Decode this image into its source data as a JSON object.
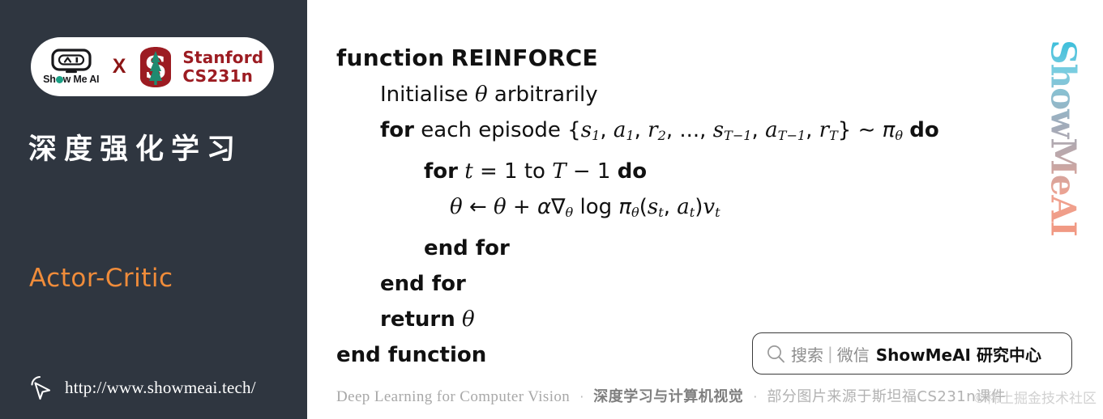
{
  "sidebar": {
    "brand": {
      "showmeai_wordmark_pre": "Sh",
      "showmeai_wordmark_post": "w Me AI",
      "cross_label": "X",
      "stanford_line1": "Stanford",
      "stanford_line2": "CS231n"
    },
    "course_title_cn": "深度强化学习",
    "topic_title": "Actor-Critic",
    "site_url": "http://www.showmeai.tech/",
    "colors": {
      "background": "#2f3640",
      "accent_orange": "#f08c3a",
      "stanford_red": "#9c1c22",
      "text_white": "#ffffff"
    }
  },
  "main": {
    "algorithm": {
      "line1_kw": "function",
      "line1_name": "REINFORCE",
      "line2": "Initialise θ arbitrarily",
      "line3_kw": "for",
      "line3_text": "each episode {s1, a1, r2, ..., sT−1, aT−1, rT} ~ πθ",
      "line3_do": "do",
      "line4_kw": "for",
      "line4_text": "t = 1 to T − 1",
      "line4_do": "do",
      "line5": "θ ← θ + α∇θ log πθ(st, at)vt",
      "line6": "end for",
      "line7": "end for",
      "line8_kw": "return",
      "line8_var": "θ",
      "line9": "end function"
    },
    "watermark_vertical": "ShowMeAI",
    "search_box": {
      "placeholder": "搜索",
      "separator": "|",
      "channel": "微信",
      "brand": "ShowMeAI 研究中心"
    },
    "footer": {
      "english": "Deep Learning for Computer Vision",
      "dot1": "·",
      "chinese_bold": "深度学习与计算机视觉",
      "dot2": "·",
      "chinese_note": "部分图片来源于斯坦福CS231n课件"
    },
    "corner_watermark": "©稀土掘金技术社区"
  }
}
